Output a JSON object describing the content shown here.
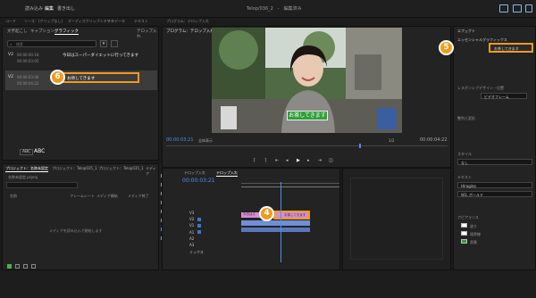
{
  "topbar": {
    "nav": [
      {
        "label": "読み込み",
        "active": false
      },
      {
        "label": "編集",
        "active": true
      },
      {
        "label": "書き出し",
        "active": false
      }
    ],
    "title": "Telop/036_2　-　編集済み"
  },
  "menubar": {
    "items": [
      "コード",
      "ソース：(クリップなし)",
      "オーディオクリップミキサー",
      "メタデータ",
      "テキスト",
      "プログラム：テロップ入れ"
    ]
  },
  "essential_graphics": {
    "tabs": [
      {
        "label": "文字起こし",
        "active": false
      },
      {
        "label": "キャプション",
        "active": false
      },
      {
        "label": "グラフィック",
        "active": true
      }
    ],
    "header_right": "テロップ入れ",
    "search_placeholder": "検索",
    "items": [
      {
        "track": "V2",
        "tc_in": "00:00:00:18",
        "tc_out": "00:00:03:05",
        "text": "今日はスーパーダイエットに行ってきます",
        "selected": false
      },
      {
        "track": "V2",
        "tc_in": "00:00:03:08",
        "tc_out": "00:00:04:22",
        "text": "お待してきます",
        "selected": true
      }
    ],
    "style_buttons": [
      "ABC",
      "ABC"
    ]
  },
  "project": {
    "tabs": [
      "プロジェクト：名称未設定",
      "プロジェクト：Telop035_1",
      "プロジェクト：Telop035_1",
      "メディア"
    ],
    "file": "名称未設定.prproj",
    "search_placeholder": "",
    "columns": [
      "名前",
      "フレームレート",
      "メディア開始",
      "メディア終了"
    ],
    "empty_message": "メディアを読み込んで開始します"
  },
  "program": {
    "title": "プログラム：テロップ入れ",
    "timecode": "00:00:03:21",
    "fit": "全体表示",
    "ratio": "1/2",
    "duration": "00:00:04:22",
    "caption": "お茶してきます"
  },
  "timeline": {
    "tabs": [
      "テロップ入れ",
      "テロップ入れ"
    ],
    "timecode": "00:00:03:21",
    "tracks": [
      "V3",
      "V2",
      "V1",
      "A1",
      "A2",
      "A3",
      "ミックス"
    ],
    "clip_labels": [
      "今日はス",
      "お茶してきます"
    ]
  },
  "effect_controls": {
    "title": "エフェクト",
    "section": "エッセンシャルグラフィックス",
    "layer_label": "お茶してきます",
    "align_label": "レスポンシブデザイン・位置",
    "pin_value": "ビデオフレーム",
    "group_label": "整列と変形",
    "style_label": "スタイル",
    "style_value": "なし",
    "text_label": "テキスト",
    "font": "Hiragino",
    "font_style": "W3, ボールド",
    "appearance_label": "アピアランス",
    "appearance": [
      {
        "label": "塗り",
        "color": "#ffffff"
      },
      {
        "label": "境界線",
        "color": "#ffffff"
      },
      {
        "label": "背景",
        "color": "#2f9f3a"
      }
    ]
  },
  "callouts": {
    "c4": "4",
    "c5": "5",
    "c6": "6"
  },
  "colors": {
    "accent": "#f39a1e",
    "caption_bg": "#2f9f3a",
    "playhead": "#4f8ef0",
    "clip_pink": "#d48fcf",
    "clip_blue": "#6f8fd6"
  }
}
